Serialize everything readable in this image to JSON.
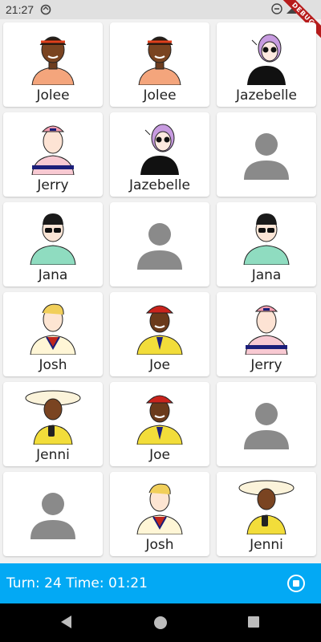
{
  "status_bar": {
    "time": "21:27",
    "debug_label": "DEBUG"
  },
  "cards": [
    {
      "name": "Jolee",
      "avatar": "jolee"
    },
    {
      "name": "Jolee",
      "avatar": "jolee"
    },
    {
      "name": "Jazebelle",
      "avatar": "jazebelle"
    },
    {
      "name": "Jerry",
      "avatar": "jerry"
    },
    {
      "name": "Jazebelle",
      "avatar": "jazebelle"
    },
    {
      "name": "",
      "avatar": "placeholder"
    },
    {
      "name": "Jana",
      "avatar": "jana"
    },
    {
      "name": "",
      "avatar": "placeholder"
    },
    {
      "name": "Jana",
      "avatar": "jana"
    },
    {
      "name": "Josh",
      "avatar": "josh"
    },
    {
      "name": "Joe",
      "avatar": "joe"
    },
    {
      "name": "Jerry",
      "avatar": "jerry"
    },
    {
      "name": "Jenni",
      "avatar": "jenni"
    },
    {
      "name": "Joe",
      "avatar": "joe"
    },
    {
      "name": "",
      "avatar": "placeholder"
    },
    {
      "name": "",
      "avatar": "placeholder"
    },
    {
      "name": "Josh",
      "avatar": "josh"
    },
    {
      "name": "Jenni",
      "avatar": "jenni"
    }
  ],
  "bottom_bar": {
    "status_text": "Turn: 24 Time: 01:21",
    "stop_icon": "stop-circle-icon"
  },
  "colors": {
    "accent": "#03a9f4",
    "placeholder": "#8a8a8a"
  }
}
